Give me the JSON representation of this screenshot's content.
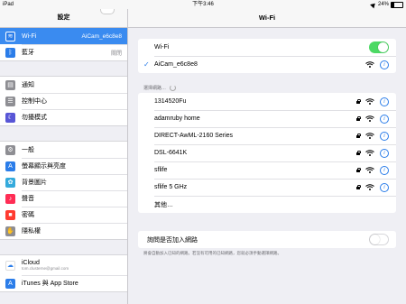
{
  "status_bar": {
    "device": "iPad",
    "time": "下午3:46",
    "battery": "24%"
  },
  "sidebar": {
    "title": "設定",
    "groups": [
      [
        {
          "label": "Wi-Fi",
          "value": "AiCam_e6c8e8",
          "icon": "wifi-icon",
          "color": "#2b7de9",
          "selected": true
        },
        {
          "label": "藍牙",
          "value": "關閉",
          "icon": "bluetooth-icon",
          "color": "#2b7de9"
        }
      ],
      [
        {
          "label": "通知",
          "icon": "notifications-icon",
          "color": "#8e8e93"
        },
        {
          "label": "控制中心",
          "icon": "control-center-icon",
          "color": "#8e8e93"
        },
        {
          "label": "勿擾模式",
          "icon": "moon-icon",
          "color": "#5856d6"
        }
      ],
      [
        {
          "label": "一般",
          "icon": "gear-icon",
          "color": "#8e8e93"
        },
        {
          "label": "螢幕顯示與亮度",
          "icon": "display-brightness-icon",
          "color": "#2b7de9"
        },
        {
          "label": "背景圖片",
          "icon": "wallpaper-icon",
          "color": "#34aadc"
        },
        {
          "label": "聲音",
          "icon": "sound-icon",
          "color": "#ff2d55"
        },
        {
          "label": "密碼",
          "icon": "passcode-icon",
          "color": "#ff3b30"
        },
        {
          "label": "隱私權",
          "icon": "privacy-hand-icon",
          "color": "#8e8e93"
        }
      ],
      [
        {
          "label": "iCloud",
          "sub": "tom.clusterne@gmail.com",
          "icon": "icloud-icon",
          "color": "#ffffff"
        },
        {
          "label": "iTunes 與 App Store",
          "icon": "app-store-icon",
          "color": "#2b7de9"
        }
      ]
    ]
  },
  "detail": {
    "title": "Wi-Fi",
    "wifi_label": "Wi-Fi",
    "wifi_on": true,
    "connected_network": "AiCam_e6c8e8",
    "choose_header": "選擇網路…",
    "networks": [
      "1314520Fu",
      "adamruby home",
      "DIRECT-AwML-2160 Series",
      "DSL-6641K",
      "sflife",
      "sflife 5 GHz"
    ],
    "other_label": "其他…",
    "ask_join_label": "詢問是否加入網路",
    "ask_join_on": false,
    "footnote": "將會自動加入已知的網路。若沒有可用的已知網路，您就必須手動選擇網路。"
  }
}
